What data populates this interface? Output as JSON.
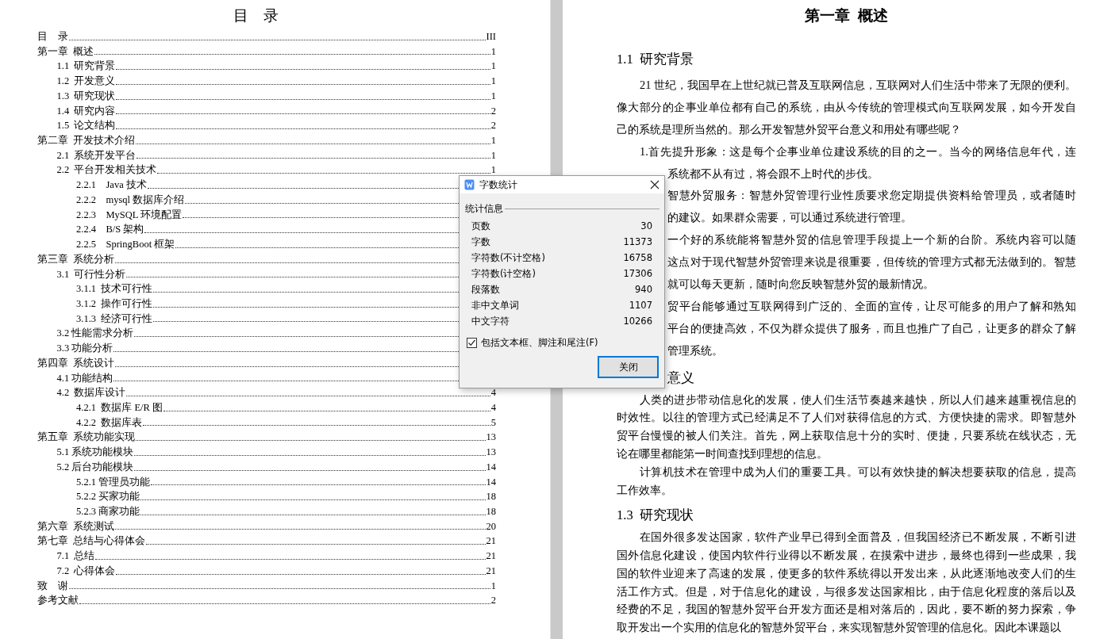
{
  "toc": {
    "title": "目　录",
    "entries": [
      {
        "text": "目　录",
        "page": "III"
      },
      {
        "text": "第一章  概述",
        "page": "1",
        "children": [
          {
            "text": "1.1  研究背景",
            "page": "1"
          },
          {
            "text": "1.2  开发意义",
            "page": "1"
          },
          {
            "text": "1.3  研究现状",
            "page": "1"
          },
          {
            "text": "1.4  研究内容",
            "page": "2"
          },
          {
            "text": "1.5  论文结构",
            "page": "2"
          }
        ]
      },
      {
        "text": "第二章  开发技术介绍",
        "page": "1",
        "children": [
          {
            "text": "2.1  系统开发平台",
            "page": "1"
          },
          {
            "text": "2.2  平台开发相关技术",
            "page": "1",
            "children": [
              {
                "text": "2.2.1    Java 技术"
              },
              {
                "text": "2.2.2    mysql 数据库介绍"
              },
              {
                "text": "2.2.3    MySQL 环境配置"
              },
              {
                "text": "2.2.4    B/S 架构"
              },
              {
                "text": "2.2.5    SpringBoot 框架"
              }
            ]
          }
        ]
      },
      {
        "text": "第三章  系统分析",
        "children": [
          {
            "text": "3.1  可行性分析",
            "children": [
              {
                "text": "3.1.1  技术可行性"
              },
              {
                "text": "3.1.2  操作可行性"
              },
              {
                "text": "3.1.3  经济可行性"
              }
            ]
          },
          {
            "text": "3.2 性能需求分析"
          },
          {
            "text": "3.3 功能分析"
          }
        ]
      },
      {
        "text": "第四章  系统设计",
        "children": [
          {
            "text": "4.1 功能结构"
          },
          {
            "text": "4.2  数据库设计",
            "page": "4",
            "children": [
              {
                "text": "4.2.1  数据库 E/R 图",
                "page": "4"
              },
              {
                "text": "4.2.2  数据库表",
                "page": "5"
              }
            ]
          }
        ]
      },
      {
        "text": "第五章  系统功能实现",
        "page": "13",
        "children": [
          {
            "text": "5.1 系统功能模块",
            "page": "13"
          },
          {
            "text": "5.2 后台功能模块",
            "page": "14",
            "children": [
              {
                "text": "5.2.1 管理员功能",
                "page": "14"
              },
              {
                "text": "5.2.2 买家功能",
                "page": "18"
              },
              {
                "text": "5.2.3 商家功能",
                "page": "18"
              }
            ]
          }
        ]
      },
      {
        "text": "第六章  系统测试",
        "page": "20"
      },
      {
        "text": "第七章  总结与心得体会",
        "page": "21",
        "children": [
          {
            "text": "7.1  总结",
            "page": "21"
          },
          {
            "text": "7.2  心得体会",
            "page": "21"
          }
        ]
      },
      {
        "text": "致　谢",
        "page": "1"
      },
      {
        "text": "参考文献",
        "page": "2"
      }
    ]
  },
  "body": {
    "title": "第一章  概述",
    "sections": [
      {
        "heading": {
          "text": "1.1  研究背景",
          "covered": false
        },
        "paragraphs": [
          {
            "lines": [
              {
                "text": "21 世纪，我国早在上世纪就已普及互联网信息，互联网对人们生活中带来了无限的便利。",
                "covered": false
              },
              {
                "text": "像大部分的企事业单位都有自己的系统，由从今传统的管理模式向互联网发展，如今开发自",
                "covered": false
              },
              {
                "text": "己的系统是理所当然的。那么开发智慧外贸平台意义和用处有哪些呢？",
                "covered": false
              }
            ]
          },
          {
            "lines": [
              {
                "text": "1.首先提升形象：这是每个企事业单位建设系统的目的之一。当今的网络信息年代，连",
                "covered": false
              },
              {
                "text": "系统都不从有过，将会跟不上时代的步伐。",
                "covered": true
              }
            ]
          },
          {
            "lines": [
              {
                "text": "智慧外贸服务：智慧外贸管理行业性质要求您定期提供资料给管理员，或者随时",
                "covered": true
              },
              {
                "text": "的建议。如果群众需要，可以通过系统进行管理。",
                "covered": true
              }
            ]
          },
          {
            "lines": [
              {
                "text": "一个好的系统能将智慧外贸的信息管理手段提上一个新的台阶。系统内容可以随",
                "covered": true
              },
              {
                "text": "这点对于现代智慧外贸管理来说是很重要，但传统的管理方式都无法做到的。智慧",
                "covered": true
              },
              {
                "text": "就可以每天更新，随时向您反映智慧外贸的最新情况。",
                "covered": true
              }
            ]
          },
          {
            "lines": [
              {
                "text": "贸平台能够通过互联网得到广泛的、全面的宣传，让尽可能多的用户了解和熟知",
                "covered": true
              },
              {
                "text": "平台的便捷高效，不仅为群众提供了服务，而且也推广了自己，让更多的群众了解",
                "covered": true
              },
              {
                "text": "管理系统。",
                "covered": true
              }
            ]
          }
        ]
      },
      {
        "heading": {
          "text": "意义",
          "covered": true
        },
        "paragraphs": [
          {
            "lines": [
              {
                "text": "人类的进步带动信息化的发展，使人们生活节奏越来越快，所以人们越来越重视信息的",
                "covered": false
              },
              {
                "text": "时效性。以往的管理方式已经满足不了人们对获得信息的方式、方便快捷的需求。即智慧外",
                "covered": false
              },
              {
                "text": "贸平台慢慢的被人们关注。首先，网上获取信息十分的实时、便捷，只要系统在线状态，无",
                "covered": false
              },
              {
                "text": "论在哪里都能第一时间查找到理想的信息。",
                "covered": false
              }
            ]
          },
          {
            "lines": [
              {
                "text": "计算机技术在管理中成为人们的重要工具。可以有效快捷的解决想要获取的信息，提高",
                "covered": false
              },
              {
                "text": "工作效率。",
                "covered": false
              }
            ]
          }
        ]
      },
      {
        "heading": {
          "text": "1.3  研究现状",
          "covered": false
        },
        "paragraphs": [
          {
            "lines": [
              {
                "text": "在国外很多发达国家，软件产业早已得到全面普及，但我国经济已不断发展，不断引进",
                "covered": false
              },
              {
                "text": "国外信息化建设，使国内软件行业得以不断发展，在摸索中进步，最终也得到一些成果，我",
                "covered": false
              },
              {
                "text": "国的软件业迎来了高速的发展，使更多的软件系统得以开发出来，从此逐渐地改变人们的生",
                "covered": false
              },
              {
                "text": "活工作方式。但是，对于信息化的建设，与很多发达国家相比，由于信息化程度的落后以及",
                "covered": false
              },
              {
                "text": "经费的不足，我国的智慧外贸平台开发方面还是相对落后的，因此，要不断的努力探索，争",
                "covered": false
              },
              {
                "text": "取开发出一个实用的信息化的智慧外贸平台，来实现智慧外贸管理的信息化。因此本课题以",
                "covered": false
              }
            ]
          }
        ]
      }
    ]
  },
  "dialog": {
    "title": "字数统计",
    "group": "统计信息",
    "stats": [
      {
        "label": "页数",
        "value": "30"
      },
      {
        "label": "字数",
        "value": "11373"
      },
      {
        "label": "字符数(不计空格)",
        "value": "16758"
      },
      {
        "label": "字符数(计空格)",
        "value": "17306"
      },
      {
        "label": "段落数",
        "value": "940"
      },
      {
        "label": "非中文单词",
        "value": "1107"
      },
      {
        "label": "中文字符",
        "value": "10266"
      }
    ],
    "option": {
      "label": "包括文本框、脚注和尾注(F)",
      "checked": true
    },
    "close_button": "关闭"
  }
}
